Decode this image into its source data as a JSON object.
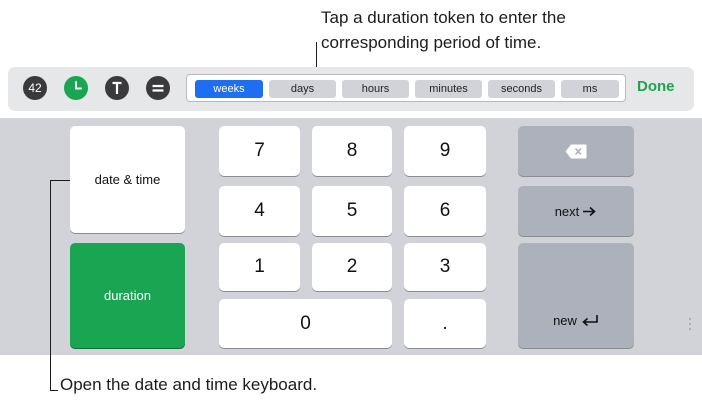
{
  "callouts": {
    "top_line1": "Tap a duration token to enter the",
    "top_line2": "corresponding period of time.",
    "bottom": "Open the date and time keyboard."
  },
  "toolbar": {
    "icons": [
      {
        "name": "number-format-icon",
        "text": "42"
      },
      {
        "name": "clock-format-icon"
      },
      {
        "name": "text-format-icon"
      },
      {
        "name": "formula-format-icon"
      }
    ],
    "tokens": [
      {
        "label": "weeks",
        "selected": true
      },
      {
        "label": "days",
        "selected": false
      },
      {
        "label": "hours",
        "selected": false
      },
      {
        "label": "minutes",
        "selected": false
      },
      {
        "label": "seconds",
        "selected": false
      },
      {
        "label": "ms",
        "selected": false
      }
    ],
    "done_label": "Done"
  },
  "keyboard": {
    "date_time_label": "date & time",
    "duration_label": "duration",
    "digits": [
      "7",
      "8",
      "9",
      "4",
      "5",
      "6",
      "1",
      "2",
      "3"
    ],
    "zero": "0",
    "decimal": ".",
    "next_label": "next",
    "new_label": "new"
  },
  "colors": {
    "accent_green": "#1aa552",
    "token_selected": "#1d6ef0",
    "keyboard_bg": "#d1d3d9",
    "toolbar_bg": "#e6e7e9"
  }
}
